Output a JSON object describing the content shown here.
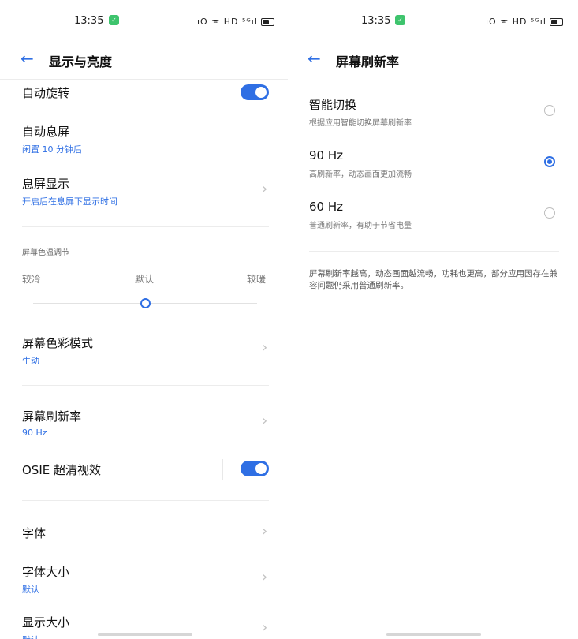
{
  "left": {
    "status": {
      "time": "13:35",
      "icons": "ıO ᯤ HD ⁵ᴳıl"
    },
    "header": {
      "back": "←",
      "title": "显示与亮度"
    },
    "auto_rotate": {
      "label": "自动旋转",
      "on": true
    },
    "auto_sleep": {
      "label": "自动息屏",
      "sub": "闲置 10 分钟后"
    },
    "aod": {
      "label": "息屏显示",
      "sub": "开启后在息屏下显示时间"
    },
    "color_temp": {
      "label": "屏幕色温调节",
      "cold": "较冷",
      "default": "默认",
      "warm": "较暖",
      "level": 0.5
    },
    "color_mode": {
      "label": "屏幕色彩模式",
      "sub": "生动"
    },
    "refresh": {
      "label": "屏幕刷新率",
      "sub": "90 Hz"
    },
    "osie": {
      "label": "OSIE 超清视效",
      "on": true
    },
    "font": {
      "label": "字体"
    },
    "font_size": {
      "label": "字体大小",
      "sub": "默认"
    },
    "display_size": {
      "label": "显示大小",
      "sub": "默认"
    },
    "chevron": "›"
  },
  "right": {
    "status": {
      "time": "13:35",
      "icons": "ıO ᯤ HD ⁵ᴳıl"
    },
    "header": {
      "back": "←",
      "title": "屏幕刷新率"
    },
    "options": [
      {
        "label": "智能切换",
        "desc": "根据应用智能切换屏幕刷新率",
        "selected": false
      },
      {
        "label": "90 Hz",
        "desc": "高刷新率，动态画面更加流畅",
        "selected": true
      },
      {
        "label": "60 Hz",
        "desc": "普通刷新率，有助于节省电量",
        "selected": false
      }
    ],
    "note": "屏幕刷新率越高，动态画面越流畅，功耗也更高，部分应用因存在兼容问题仍采用普通刷新率。"
  },
  "colors": {
    "accent": "#2f6fe4",
    "text": "#111111",
    "secondary": "#777777"
  },
  "icon_names": [
    "back-arrow-icon",
    "chevron-right-icon",
    "wifi-icon",
    "battery-icon",
    "signal-icon",
    "vibrate-icon"
  ]
}
